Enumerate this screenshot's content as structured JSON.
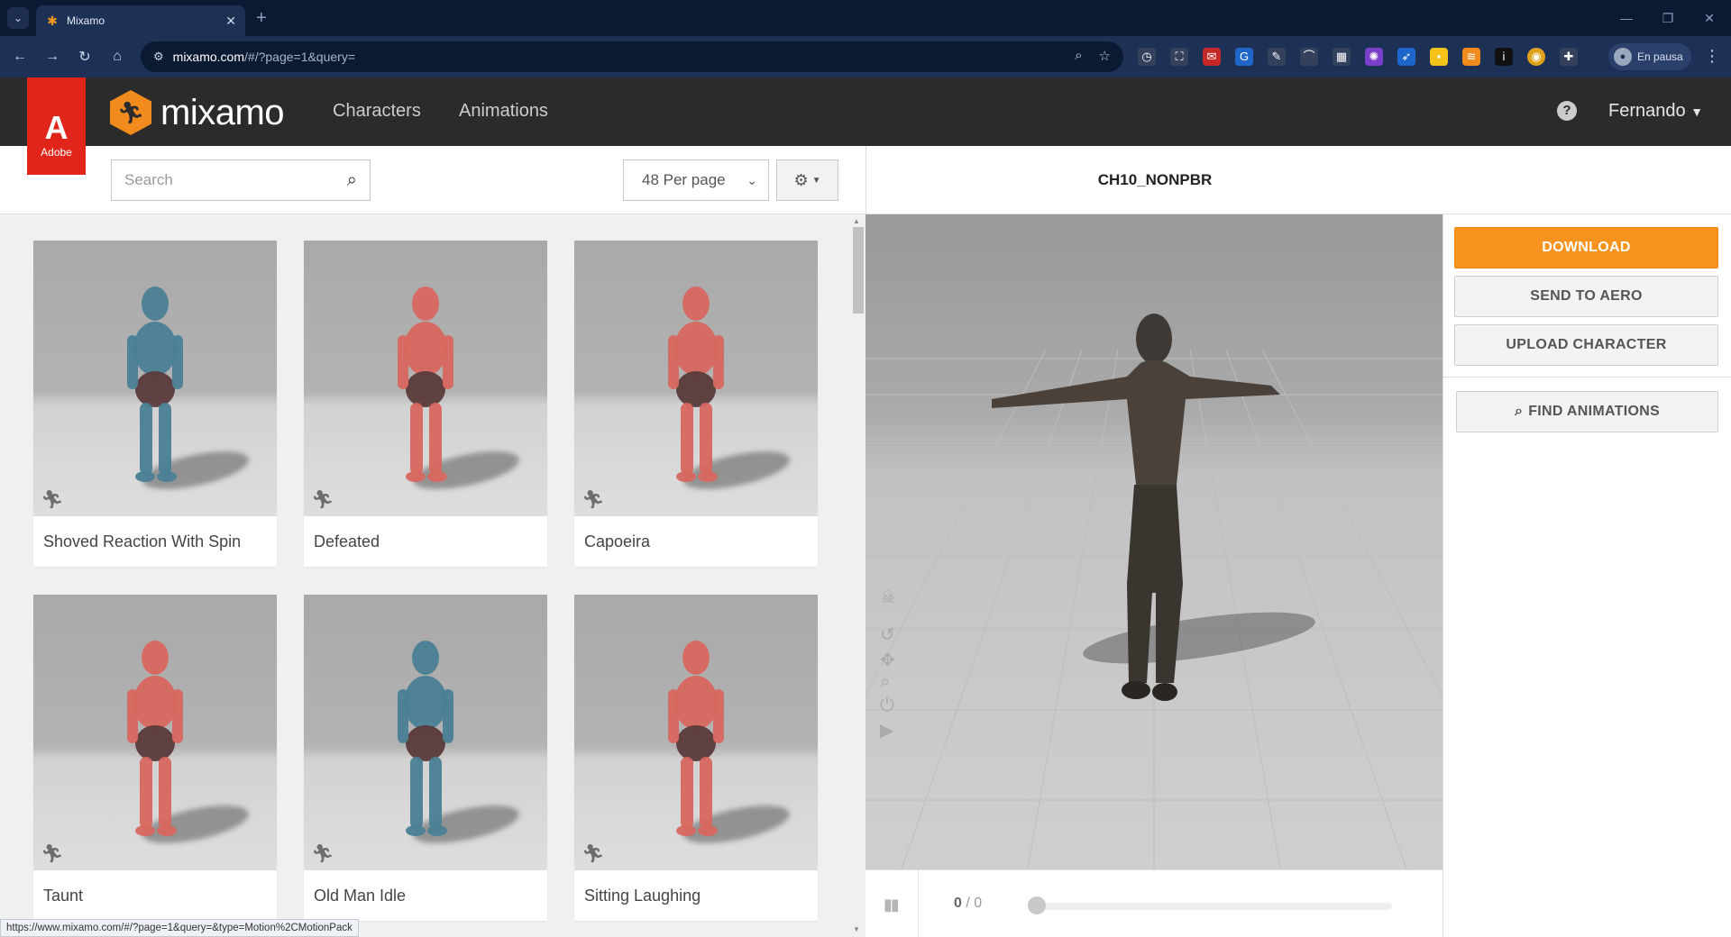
{
  "browser": {
    "tab_title": "Mixamo",
    "url_host": "mixamo.com",
    "url_path": "/#/?page=1&query=",
    "profile_label": "En pausa",
    "status_url": "https://www.mixamo.com/#/?page=1&query=&type=Motion%2CMotionPack"
  },
  "header": {
    "adobe_label": "Adobe",
    "logo_text": "mixamo",
    "nav": [
      "Characters",
      "Animations"
    ],
    "user_name": "Fernando",
    "help_glyph": "?"
  },
  "toolbar": {
    "search_placeholder": "Search",
    "per_page": "48 Per page"
  },
  "animations": [
    {
      "label": "Shoved Reaction With Spin",
      "color": "#4a7f95"
    },
    {
      "label": "Defeated",
      "color": "#d8675f"
    },
    {
      "label": "Capoeira",
      "color": "#d8675f"
    },
    {
      "label": "Taunt",
      "color": "#d8675f"
    },
    {
      "label": "Old Man Idle",
      "color": "#4a7f95"
    },
    {
      "label": "Sitting Laughing",
      "color": "#d8675f"
    }
  ],
  "viewer": {
    "character_name": "CH10_NONPBR",
    "frame_current": "0",
    "frame_total": "/ 0"
  },
  "actions": {
    "download": "DOWNLOAD",
    "send_to_aero": "SEND TO AERO",
    "upload_character": "UPLOAD CHARACTER",
    "find_animations": "FIND ANIMATIONS"
  },
  "colors": {
    "accent": "#f7931e",
    "adobe_red": "#e1251b",
    "header_bg": "#2b2b2b"
  }
}
